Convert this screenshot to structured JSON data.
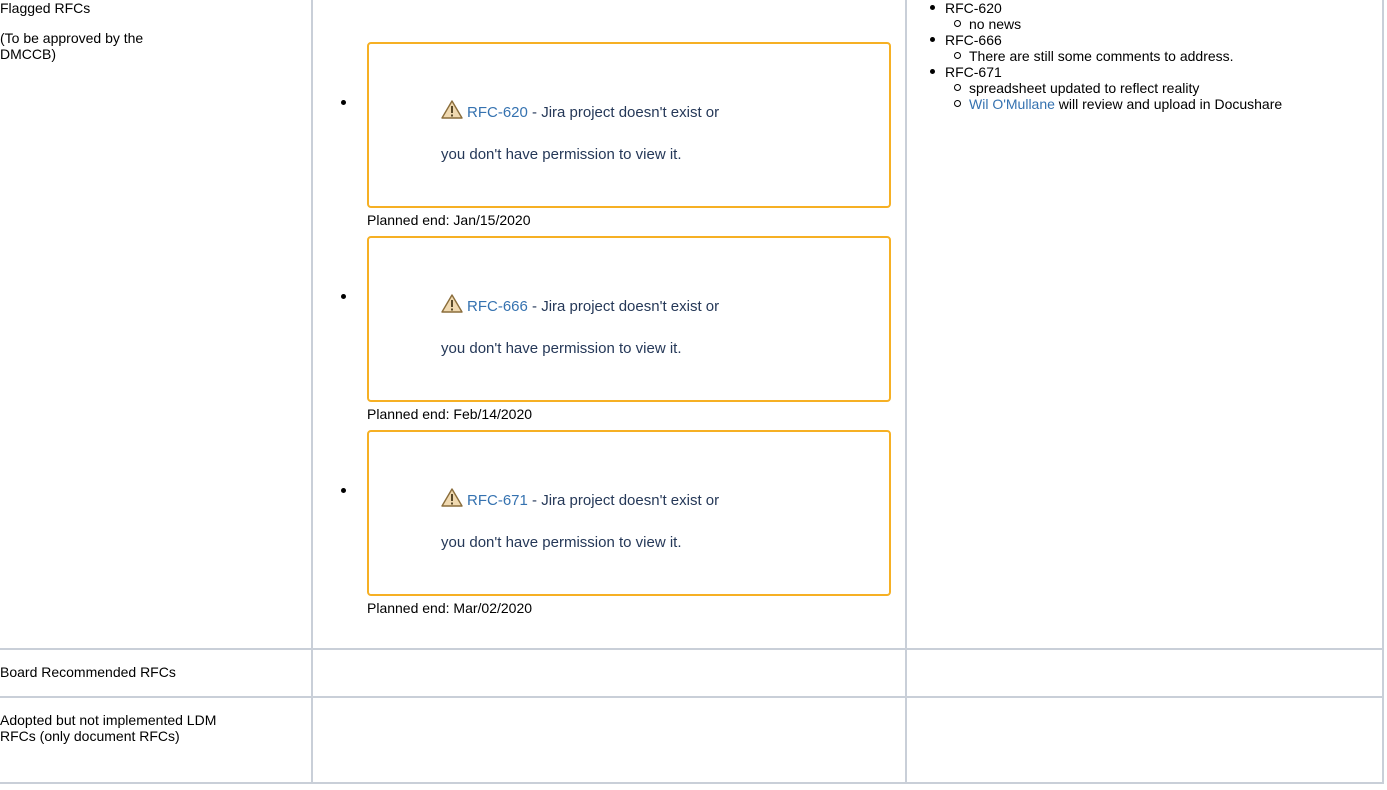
{
  "rows": [
    {
      "label_lines": [
        "Flagged RFCs",
        "(To be approved by the DMCCB)"
      ],
      "rfcs": [
        {
          "key": "RFC-620",
          "message_part1": " - Jira project doesn't exist or",
          "message_part2": "you don't have permission to view it.",
          "planned_end": "Planned end: Jan/15/2020"
        },
        {
          "key": "RFC-666",
          "message_part1": " - Jira project doesn't exist or",
          "message_part2": "you don't have permission to view it.",
          "planned_end": "Planned end: Feb/14/2020"
        },
        {
          "key": "RFC-671",
          "message_part1": " - Jira project doesn't exist or",
          "message_part2": "you don't have permission to view it.",
          "planned_end": "Planned end: Mar/02/2020"
        }
      ],
      "notes": [
        {
          "title": "RFC-620",
          "subs": [
            {
              "text": "no news"
            }
          ]
        },
        {
          "title": "RFC-666",
          "subs": [
            {
              "text": "There are still some comments to address."
            }
          ]
        },
        {
          "title": "RFC-671",
          "subs": [
            {
              "text": "spreadsheet updated to reflect reality"
            },
            {
              "mention": "Wil O'Mullane",
              "text": " will review and upload in Docushare"
            }
          ]
        }
      ]
    },
    {
      "label": "Board Recommended RFCs"
    },
    {
      "label": "Adopted but not implemented LDM RFCs (only document RFCs)"
    }
  ],
  "icons": {
    "warning": "warning-triangle-icon"
  },
  "colors": {
    "link": "#3572b0",
    "box_border": "#f6b024",
    "grid": "#c9cfd8"
  }
}
